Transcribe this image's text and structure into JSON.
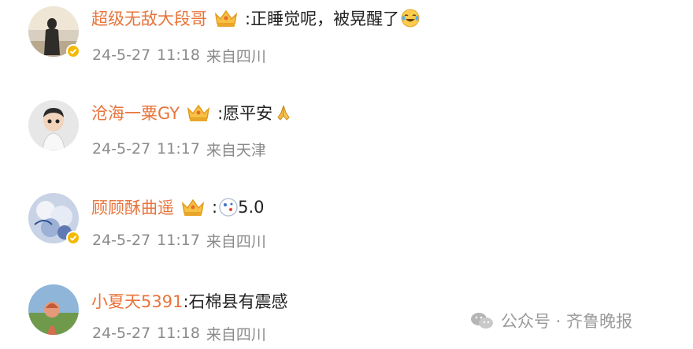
{
  "comments": [
    {
      "username": "超级无敌大段哥",
      "has_crown": true,
      "text": ":正睡觉呢，被晃醒了",
      "emoji": "laughing-tears-emoji",
      "date": "24-5-27",
      "time": "11:18",
      "location": "来自四川",
      "verified": true
    },
    {
      "username": "沧海一粟GY",
      "has_crown": true,
      "text": ":愿平安",
      "emoji": "praying-hands-emoji",
      "date": "24-5-27",
      "time": "11:17",
      "location": "来自天津",
      "verified": false
    },
    {
      "username": "顾顾酥曲遥",
      "has_crown": true,
      "text": ":",
      "emoji": "dice-emoji",
      "text_after": "5.0",
      "date": "24-5-27",
      "time": "11:17",
      "location": "来自四川",
      "verified": true
    },
    {
      "username": "小夏天5391",
      "has_crown": false,
      "text": ":石棉县有震感",
      "date": "24-5-27",
      "time": "11:18",
      "location": "来自四川",
      "verified": false
    }
  ],
  "watermark": {
    "text": "公众号 · 齐鲁晚报",
    "icon": "wechat-icon"
  },
  "colors": {
    "username": "#e8743b",
    "meta": "#8a8a8a",
    "text": "#222222",
    "verified_badge": "#f5b800"
  }
}
